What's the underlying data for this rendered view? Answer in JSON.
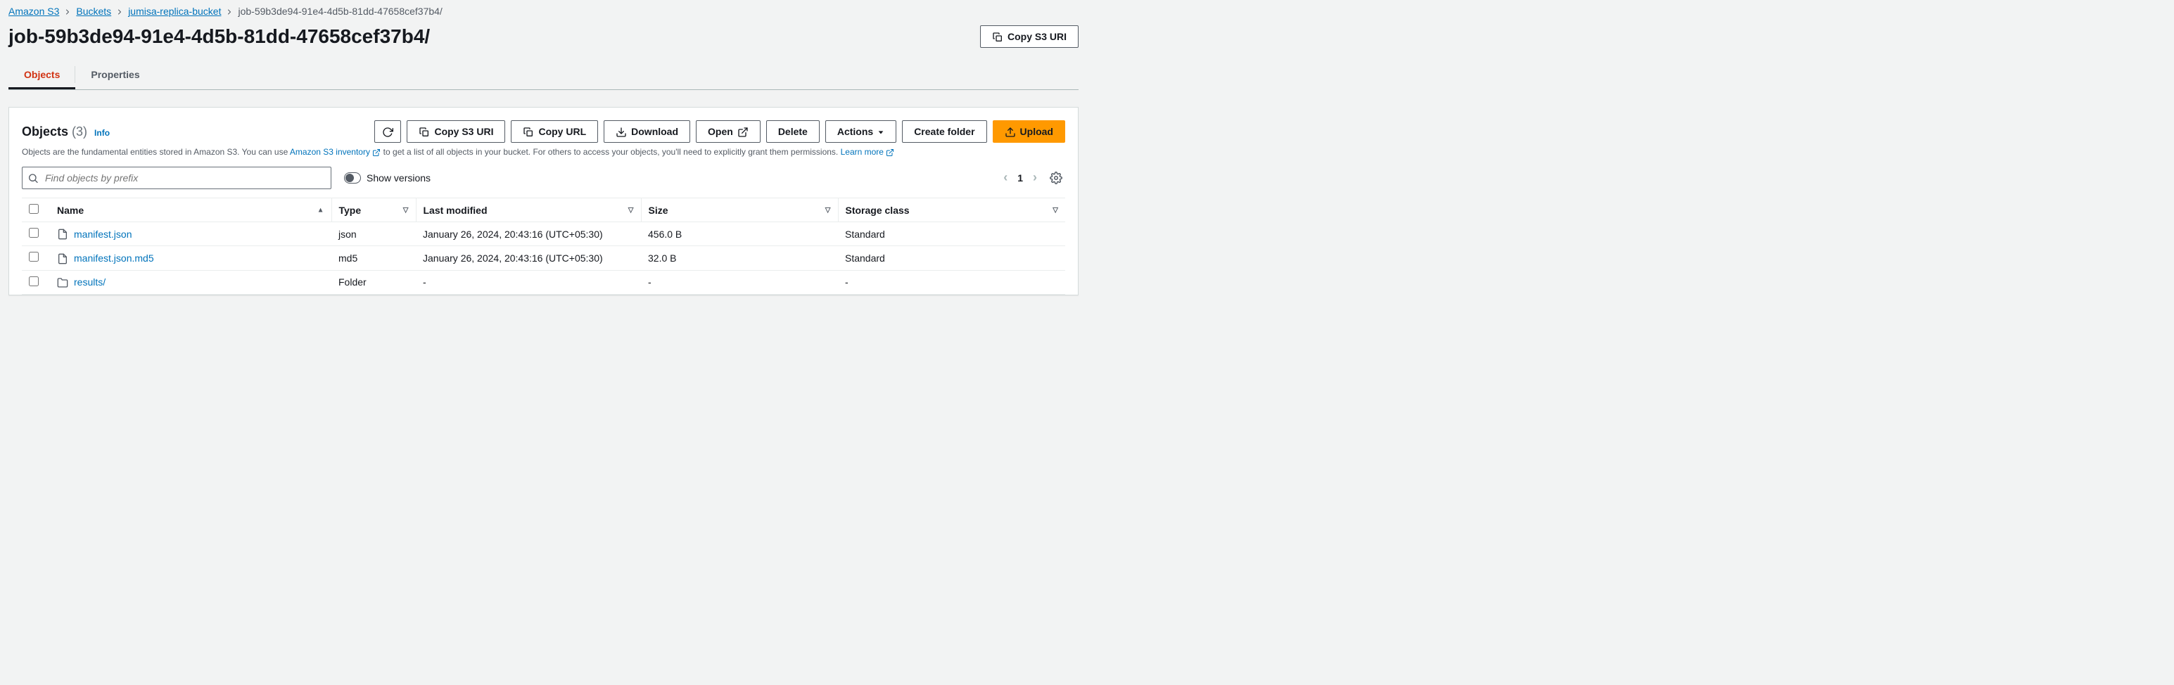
{
  "breadcrumb": [
    {
      "label": "Amazon S3",
      "link": true
    },
    {
      "label": "Buckets",
      "link": true
    },
    {
      "label": "jumisa-replica-bucket",
      "link": true
    },
    {
      "label": "job-59b3de94-91e4-4d5b-81dd-47658cef37b4/",
      "link": false
    }
  ],
  "page_title": "job-59b3de94-91e4-4d5b-81dd-47658cef37b4/",
  "header_button": "Copy S3 URI",
  "tabs": [
    {
      "label": "Objects",
      "active": true
    },
    {
      "label": "Properties",
      "active": false
    }
  ],
  "panel": {
    "title": "Objects",
    "count": "(3)",
    "info": "Info",
    "desc_pre": "Objects are the fundamental entities stored in Amazon S3. You can use ",
    "desc_link1": "Amazon S3 inventory",
    "desc_mid": " to get a list of all objects in your bucket. For others to access your objects, you'll need to explicitly grant them permissions. ",
    "desc_link2": "Learn more"
  },
  "toolbar": {
    "copy_s3_uri": "Copy S3 URI",
    "copy_url": "Copy URL",
    "download": "Download",
    "open": "Open",
    "delete": "Delete",
    "actions": "Actions",
    "create_folder": "Create folder",
    "upload": "Upload"
  },
  "search": {
    "placeholder": "Find objects by prefix",
    "toggle_label": "Show versions"
  },
  "pager": {
    "page": "1"
  },
  "columns": {
    "name": "Name",
    "type": "Type",
    "last_modified": "Last modified",
    "size": "Size",
    "storage_class": "Storage class"
  },
  "rows": [
    {
      "name": "manifest.json",
      "icon": "file",
      "type": "json",
      "modified": "January 26, 2024, 20:43:16 (UTC+05:30)",
      "size": "456.0 B",
      "class": "Standard"
    },
    {
      "name": "manifest.json.md5",
      "icon": "file",
      "type": "md5",
      "modified": "January 26, 2024, 20:43:16 (UTC+05:30)",
      "size": "32.0 B",
      "class": "Standard"
    },
    {
      "name": "results/",
      "icon": "folder",
      "type": "Folder",
      "modified": "-",
      "size": "-",
      "class": "-"
    }
  ]
}
